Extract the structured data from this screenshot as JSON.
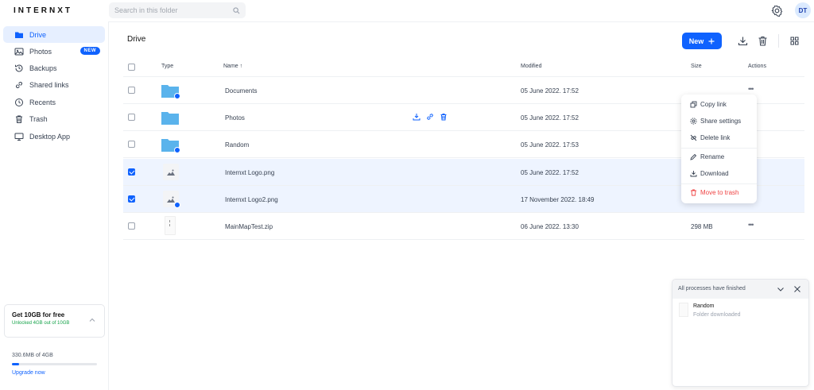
{
  "app": {
    "logo": "INTERNXT"
  },
  "search": {
    "placeholder": "Search in this folder"
  },
  "user": {
    "initials": "DT"
  },
  "sidebar": {
    "items": [
      {
        "label": "Drive",
        "icon": "folder-icon",
        "active": true
      },
      {
        "label": "Photos",
        "icon": "photo-icon",
        "badge": "NEW"
      },
      {
        "label": "Backups",
        "icon": "clock-rotate-icon"
      },
      {
        "label": "Shared links",
        "icon": "link-icon"
      },
      {
        "label": "Recents",
        "icon": "clock-icon"
      },
      {
        "label": "Trash",
        "icon": "trash-icon"
      },
      {
        "label": "Desktop App",
        "icon": "desktop-icon"
      }
    ],
    "promo": {
      "title": "Get 10GB for free",
      "subtitle": "Unlocked 4GB out of 10GB"
    },
    "usage": {
      "text": "330.6MB of 4GB",
      "upgrade": "Upgrade now",
      "fraction": 0.08
    }
  },
  "main": {
    "title": "Drive",
    "new_button": "New",
    "columns": {
      "type": "Type",
      "name": "Name",
      "modified": "Modified",
      "size": "Size",
      "actions": "Actions"
    },
    "rows": [
      {
        "name": "Documents",
        "modified": "05 June 2022. 17:52",
        "size": "",
        "type": "folder",
        "selected": false,
        "shared": true
      },
      {
        "name": "Photos",
        "modified": "05 June 2022. 17:52",
        "size": "",
        "type": "folder",
        "selected": false,
        "shared": false
      },
      {
        "name": "Random",
        "modified": "05 June 2022. 17:53",
        "size": "",
        "type": "folder",
        "selected": false,
        "shared": true
      },
      {
        "name": "Internxt Logo.png",
        "modified": "05 June 2022. 17:52",
        "size": "",
        "type": "image",
        "selected": true,
        "shared": false
      },
      {
        "name": "Internxt Logo2.png",
        "modified": "17 November 2022. 18:49",
        "size": "",
        "type": "image",
        "selected": true,
        "shared": true
      },
      {
        "name": "MainMapTest.zip",
        "modified": "06 June 2022. 13:30",
        "size": "298 MB",
        "type": "zip",
        "selected": false,
        "shared": false
      }
    ]
  },
  "context_menu": {
    "items": [
      "Copy link",
      "Share settings",
      "Delete link",
      "Rename",
      "Download",
      "Move to trash"
    ]
  },
  "processes": {
    "title": "All processes have finished",
    "item_name": "Random",
    "item_status": "Folder downloaded"
  },
  "colors": {
    "accent": "#0f62fe",
    "folder": "#5ab3ec",
    "danger": "#ef4444"
  }
}
